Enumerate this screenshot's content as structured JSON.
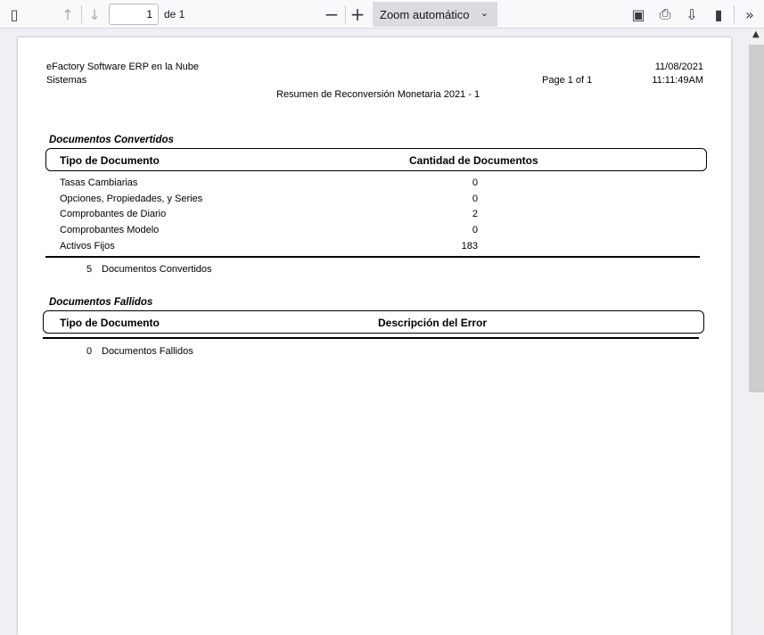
{
  "toolbar": {
    "page_value": "1",
    "page_of": "de 1",
    "zoom_label": "Zoom automático"
  },
  "report": {
    "company": "eFactory Software ERP en la Nube",
    "dept": "Sistemas",
    "page": "Page 1 of 1",
    "date": "11/08/2021",
    "time": "11:11:49AM",
    "title": "Resumen de Reconversión Monetaria 2021 - 1",
    "converted": {
      "heading": "Documentos Convertidos",
      "col1": "Tipo de Documento",
      "col2": "Cantidad de Documentos",
      "rows": [
        {
          "name": "Tasas Cambiarias",
          "count": "0"
        },
        {
          "name": "Opciones, Propiedades, y Series",
          "count": "0"
        },
        {
          "name": "Comprobantes de Diario",
          "count": "2"
        },
        {
          "name": "Comprobantes Modelo",
          "count": "0"
        },
        {
          "name": "Activos Fijos",
          "count": "183"
        }
      ],
      "total": "5",
      "total_label": "Documentos Convertidos"
    },
    "failed": {
      "heading": "Documentos Fallidos",
      "col1": "Tipo de Documento",
      "col2": "Descripción del Error",
      "total": "0",
      "total_label": "Documentos Fallidos"
    }
  }
}
